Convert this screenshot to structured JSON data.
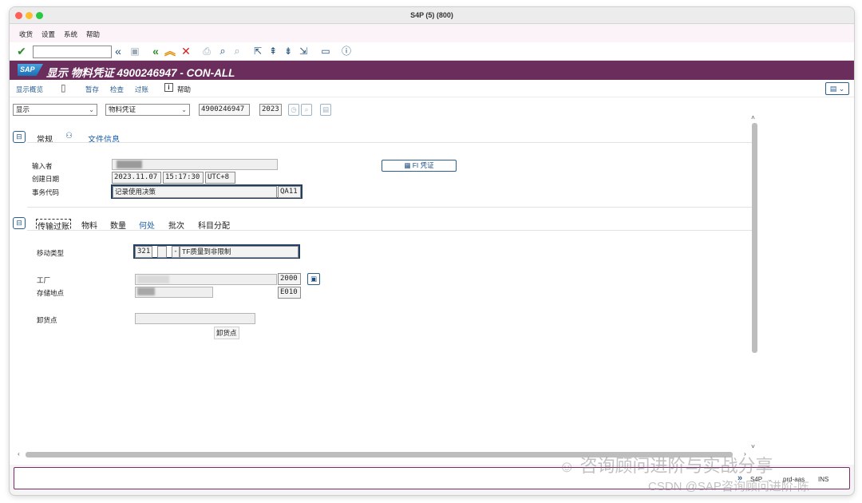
{
  "window": {
    "title": "S4P (5) (800)"
  },
  "menu": {
    "items": [
      "收货",
      "设置",
      "系统",
      "帮助"
    ]
  },
  "toolbar": {
    "command_value": "",
    "icons": [
      "enter-check-icon",
      "back-double-icon",
      "save-icon",
      "back-icon",
      "exit-icon",
      "cancel-icon",
      "print-icon",
      "find-icon",
      "find-next-icon",
      "first-page-icon",
      "previous-page-icon",
      "next-page-icon",
      "last-page-icon",
      "new-session-icon",
      "help-icon"
    ]
  },
  "banner": {
    "title": "显示 物料凭证 4900246947 - CON-ALL"
  },
  "app_toolbar": {
    "overview": "显示概览",
    "hold": "暂存",
    "check": "检查",
    "post": "过账",
    "help": "帮助"
  },
  "selection": {
    "action": "显示",
    "reference": "物料凭证",
    "doc_number": "4900246947",
    "year": "2023"
  },
  "header_tabs": {
    "general": "常规",
    "doc_info": "文件信息"
  },
  "doc_info": {
    "entered_by_label": "输入者",
    "created_label": "创建日期",
    "created_date": "2023.11.07",
    "created_time": "15:17:30",
    "timezone": "UTC+8",
    "tcode_label": "事务代码",
    "tcode_text": "记录使用决策",
    "tcode": "QA11",
    "fi_button": "FI 凭证"
  },
  "item_tabs": [
    "传输过账",
    "物料",
    "数量",
    "何处",
    "批次",
    "科目分配"
  ],
  "where": {
    "movement_label": "移动类型",
    "movement_type": "321",
    "movement_sign": "",
    "movement_minus": "-",
    "movement_text": "TF质量到非限制",
    "plant_label": "工厂",
    "plant": "2000",
    "sloc_label": "存储地点",
    "sloc": "E010",
    "unloading_label": "卸货点",
    "unloading_value": "",
    "unloading_button": "卸货点"
  },
  "status_bar": {
    "system": "S4P",
    "server": "prd-aas",
    "mode": "INS"
  },
  "watermark": {
    "line1": "咨询顾问进阶与实战分享",
    "line2": "CSDN @SAP咨询顾问进阶-陈"
  }
}
